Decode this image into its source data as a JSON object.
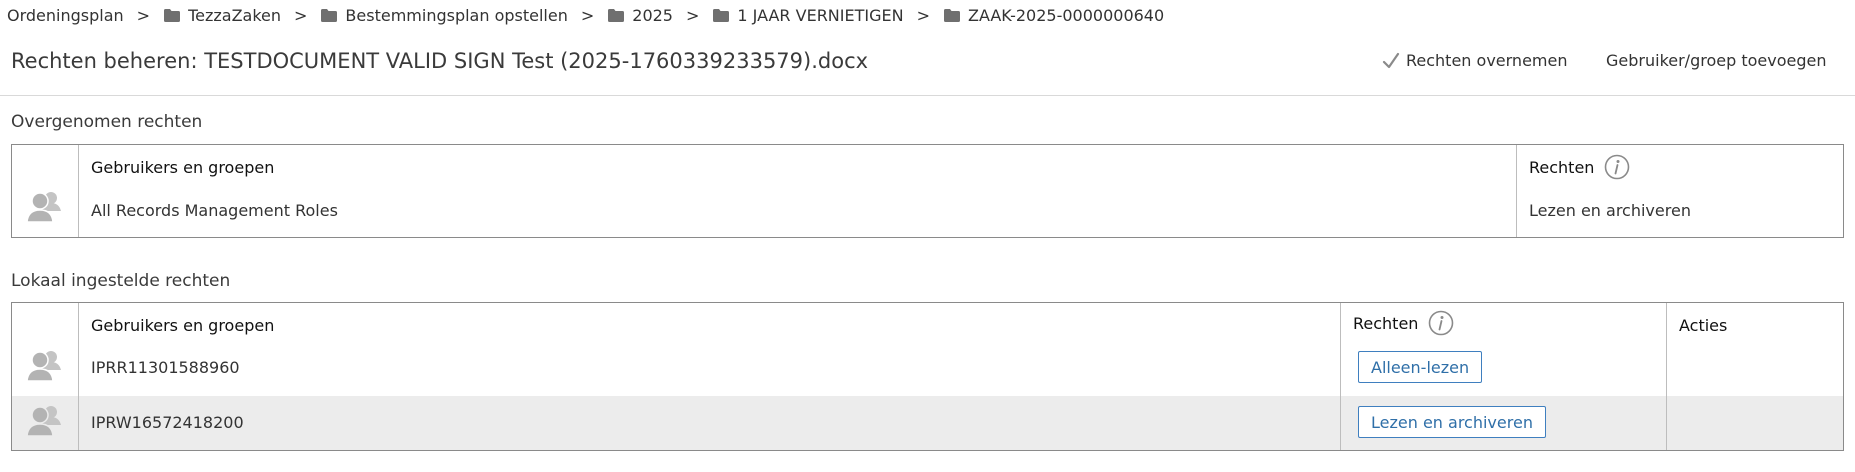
{
  "breadcrumb": {
    "root": "Ordeningsplan",
    "separator": ">",
    "items": [
      "TezzaZaken",
      "Bestemmingsplan opstellen",
      "2025",
      "1 JAAR VERNIETIGEN",
      "ZAAK-2025-0000000640"
    ]
  },
  "header": {
    "title": "Rechten beheren: TESTDOCUMENT VALID SIGN Test (2025-1760339233579).docx",
    "inherit_label": "Rechten overnemen",
    "add_label": "Gebruiker/groep toevoegen"
  },
  "inherited": {
    "section_title": "Overgenomen rechten",
    "col_users": "Gebruikers en groepen",
    "col_rights": "Rechten",
    "rows": [
      {
        "user": "All Records Management Roles",
        "rights": "Lezen en archiveren"
      }
    ]
  },
  "local": {
    "section_title": "Lokaal ingestelde rechten",
    "col_users": "Gebruikers en groepen",
    "col_rights": "Rechten",
    "col_actions": "Acties",
    "rows": [
      {
        "user": "IPRR11301588960",
        "rights": "Alleen-lezen"
      },
      {
        "user": "IPRW16572418200",
        "rights": "Lezen en archiveren"
      }
    ]
  },
  "colors": {
    "button_border": "#3f7fbf",
    "button_text": "#2f6fa8",
    "row_alt": "#ececec",
    "icon_gray": "#b3b3b3"
  }
}
